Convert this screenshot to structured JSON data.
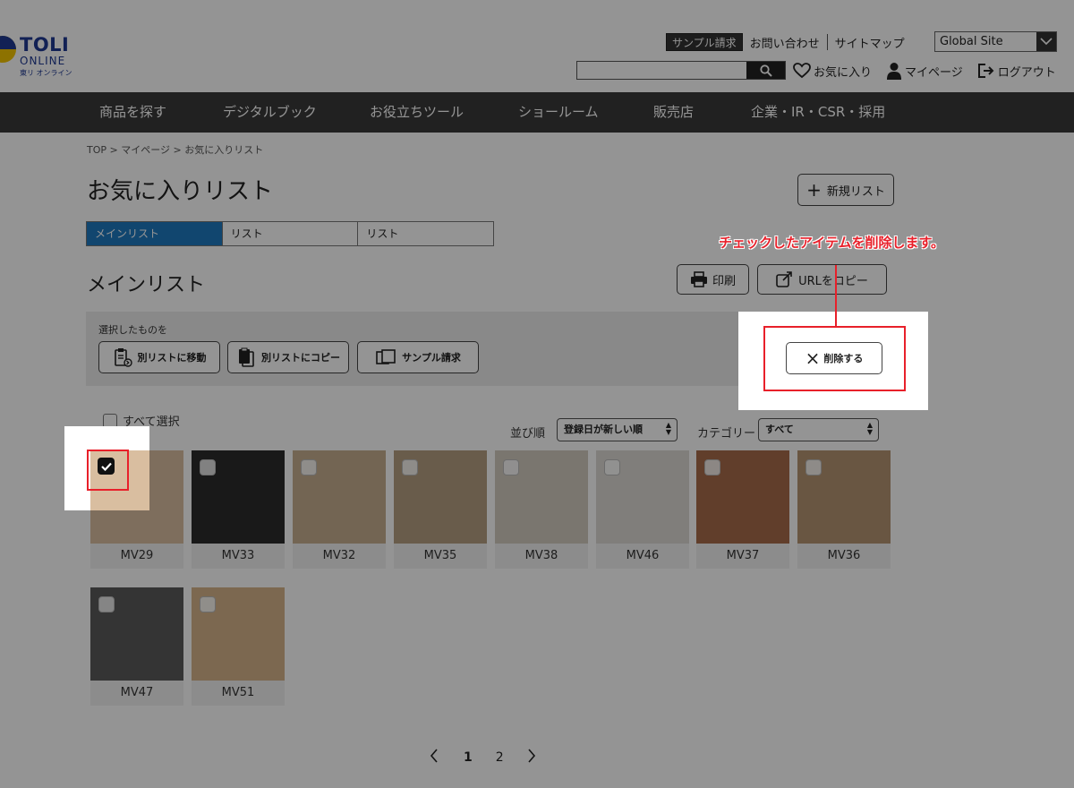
{
  "logo": {
    "title": "TOLI",
    "sub": "ONLINE",
    "jp": "東リ オンライン"
  },
  "header": {
    "sample_request": "サンプル請求",
    "contact": "お問い合わせ",
    "sitemap": "サイトマップ",
    "global_site": "Global Site",
    "search_placeholder": "",
    "favorites": "お気に入り",
    "mypage": "マイページ",
    "logout": "ログアウト"
  },
  "nav": [
    "商品を探す",
    "デジタルブック",
    "お役立ちツール",
    "ショールーム",
    "販売店",
    "企業・IR・CSR・採用"
  ],
  "breadcrumb": "TOP > マイページ > お気に入りリスト",
  "page": {
    "title": "お気に入りリスト",
    "new_list": "新規リスト",
    "tabs": [
      "メインリスト",
      "リスト",
      "リスト"
    ],
    "active_tab": 0,
    "section_title": "メインリスト",
    "print": "印刷",
    "copy_url": "URLをコピー"
  },
  "actions": {
    "label": "選択したものを",
    "move": "別リストに移動",
    "copy": "別リストにコピー",
    "sample": "サンプル請求",
    "delete": "削除する"
  },
  "annotation": "チェックしたアイテムを削除します。",
  "filters": {
    "select_all": "すべて選択",
    "sort_label": "並び順",
    "sort_value": "登録日が新しい順",
    "category_label": "カテゴリー",
    "category_value": "すべて"
  },
  "items": [
    {
      "name": "MV29",
      "color": "#d9bea0",
      "checked": true
    },
    {
      "name": "MV33",
      "color": "#2b2b2b",
      "checked": false
    },
    {
      "name": "MV32",
      "color": "#c6af8f",
      "checked": false
    },
    {
      "name": "MV35",
      "color": "#b59f82",
      "checked": false
    },
    {
      "name": "MV38",
      "color": "#d3cbc0",
      "checked": false
    },
    {
      "name": "MV46",
      "color": "#dcdad5",
      "checked": false
    },
    {
      "name": "MV37",
      "color": "#a76b4a",
      "checked": false
    },
    {
      "name": "MV36",
      "color": "#b69573",
      "checked": false
    },
    {
      "name": "MV47",
      "color": "#5a5a5a",
      "checked": false
    },
    {
      "name": "MV51",
      "color": "#d6b48a",
      "checked": false
    }
  ],
  "pagination": {
    "pages": [
      "1",
      "2"
    ],
    "current": "1"
  },
  "colors": {
    "accent_tab": "#1e79c0",
    "annotation_red": "#e8202a",
    "nav_bg": "#3a3a3a"
  }
}
